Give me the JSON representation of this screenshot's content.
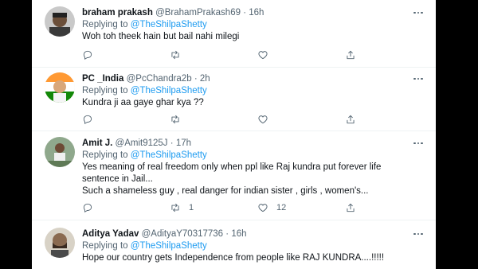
{
  "tweets": [
    {
      "name": "braham prakash",
      "handle": "@BrahamPrakash69",
      "time": "16h",
      "replying_prefix": "Replying to",
      "replying_to": "@TheShilpaShetty",
      "text": "Woh toh theek hain but bail nahi milegi",
      "retweets": "",
      "likes": ""
    },
    {
      "name": "PC _India",
      "handle": "@PcChandra2b",
      "time": "2h",
      "replying_prefix": "Replying to",
      "replying_to": "@TheShilpaShetty",
      "text": "Kundra ji aa gaye ghar kya ??",
      "retweets": "",
      "likes": ""
    },
    {
      "name": "Amit J.",
      "handle": "@Amit9125J",
      "time": "17h",
      "replying_prefix": "Replying to",
      "replying_to": "@TheShilpaShetty",
      "text_line1": "Yes meaning of real freedom only when ppl like Raj kundra put forever life",
      "text_line2": "sentence in Jail...",
      "text_line3": "Such a shameless guy , real danger for indian sister , girls , women's...",
      "retweets": "1",
      "likes": "12"
    },
    {
      "name": "Aditya Yadav",
      "handle": "@AdityaY70317736",
      "time": "16h",
      "replying_prefix": "Replying to",
      "replying_to": "@TheShilpaShetty",
      "text": "Hope our country gets Independence from people like RAJ KUNDRA....!!!!!"
    }
  ],
  "icons": [
    "reply-icon",
    "retweet-icon",
    "like-icon",
    "share-icon",
    "more-icon"
  ],
  "colors": {
    "link": "#1d9bf0",
    "muted": "#536471",
    "text": "#0f1419",
    "background": "#000000"
  }
}
